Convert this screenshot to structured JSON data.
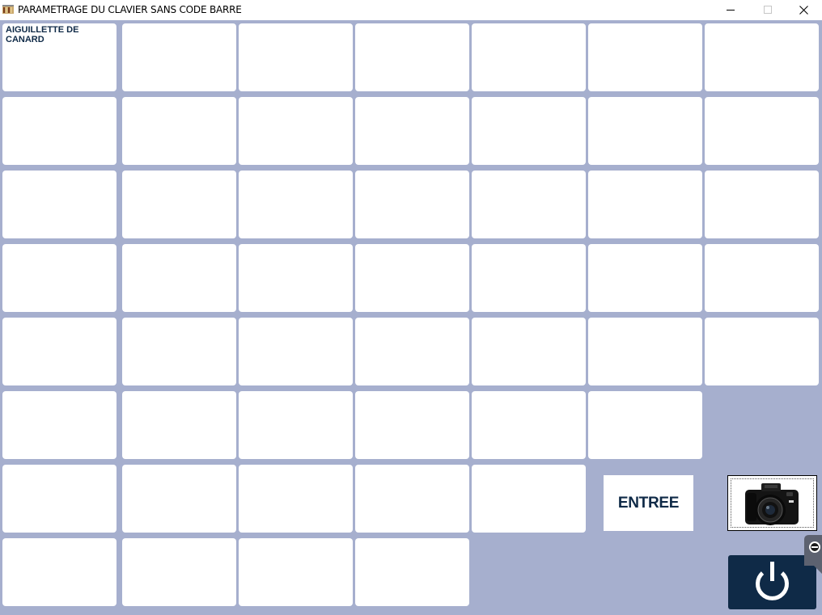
{
  "window": {
    "title": "PARAMETRAGE DU CLAVIER SANS CODE BARRE"
  },
  "colors": {
    "background": "#a6afce",
    "key": "#ffffff",
    "label": "#0f2a47",
    "power_button": "#0f2a47"
  },
  "grid": {
    "rows": [
      [
        "AIGUILLETTE DE CANARD",
        "",
        "",
        "",
        "",
        "",
        ""
      ],
      [
        "",
        "",
        "",
        "",
        "",
        "",
        ""
      ],
      [
        "",
        "",
        "",
        "",
        "",
        "",
        ""
      ],
      [
        "",
        "",
        "",
        "",
        "",
        "",
        ""
      ],
      [
        "",
        "",
        "",
        "",
        "",
        "",
        ""
      ],
      [
        "",
        "",
        "",
        "",
        "",
        ""
      ],
      [
        "",
        "",
        "",
        "",
        ""
      ],
      [
        "",
        "",
        "",
        ""
      ]
    ]
  },
  "buttons": {
    "entree_label": "ENTREE",
    "camera_icon": "camera-icon",
    "power_icon": "power-icon"
  }
}
